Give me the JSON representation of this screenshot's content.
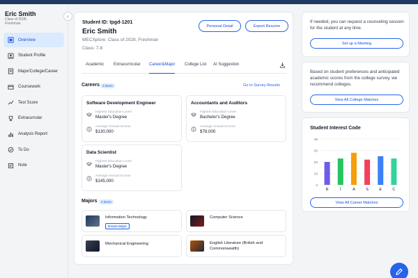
{
  "student": {
    "name": "Eric Smith",
    "class_line": "Class of 2028,",
    "level": "Freshman",
    "id_label": "Student ID: tpgd-1201",
    "full_class": "MECXplore: Class of 2028, Freshman",
    "grade": "Class: 7-8"
  },
  "sidebar": {
    "items": [
      {
        "label": "Overview",
        "icon": "grid-icon"
      },
      {
        "label": "Student Profile",
        "icon": "user-icon"
      },
      {
        "label": "Major/College/Career",
        "icon": "book-icon"
      },
      {
        "label": "Coursework",
        "icon": "clipboard-icon"
      },
      {
        "label": "Test Score",
        "icon": "trend-icon"
      },
      {
        "label": "Extracurrular",
        "icon": "trophy-icon"
      },
      {
        "label": "Analysis Report",
        "icon": "bar-chart-icon"
      },
      {
        "label": "To Do",
        "icon": "check-circle-icon"
      },
      {
        "label": "Note",
        "icon": "note-icon"
      }
    ]
  },
  "header": {
    "personal_detail": "Personal Detail",
    "export_resume": "Export Resume"
  },
  "tabs": [
    "Academic",
    "Extracurricular",
    "Career&Major",
    "College List",
    "AI Suggestion"
  ],
  "careers": {
    "title": "Careers",
    "count": "3 items",
    "survey_link": "Go to Survey Results",
    "edu_label": "Highest Education Level",
    "income_label": "Average Annual Income",
    "items": [
      {
        "name": "Software Development Engineer",
        "edu": "Master's Degree",
        "income": "$130,000"
      },
      {
        "name": "Accountants and Auditors",
        "edu": "Bachelor's Degree",
        "income": "$78,000"
      },
      {
        "name": "Data Scientist",
        "edu": "Master's Degree",
        "income": "$145,000"
      }
    ]
  },
  "majors": {
    "title": "Majors",
    "count": "3 items",
    "dream": "Dream Major",
    "items": [
      {
        "name": "Information Technology"
      },
      {
        "name": "Computer Science"
      },
      {
        "name": "Mechanical Engineering"
      },
      {
        "name": "English Literature (British and Commonwealth)"
      }
    ]
  },
  "right": {
    "counsel_text": "If needed, you can request a counseling session for the student at any time.",
    "meeting_btn": "Set up a Meeting",
    "college_text": "Based on student preferences and anticipated academic scores from the college survey, we recommend colleges.",
    "college_btn": "View All College Matches",
    "interest_title": "Student Interest Code",
    "career_btn": "View All Career Matches"
  },
  "chart_data": {
    "type": "bar",
    "title": "Student Interest Code",
    "categories": [
      "R",
      "I",
      "A",
      "S",
      "E",
      "C"
    ],
    "values": [
      20,
      23,
      28,
      22,
      25,
      23
    ],
    "colors": [
      "#6d5ce7",
      "#22c55e",
      "#f59e0b",
      "#f43f5e",
      "#3b82f6",
      "#34d399"
    ],
    "ylim": [
      0,
      40
    ],
    "yticks": [
      0,
      10,
      20,
      30,
      40
    ],
    "grid": true
  }
}
